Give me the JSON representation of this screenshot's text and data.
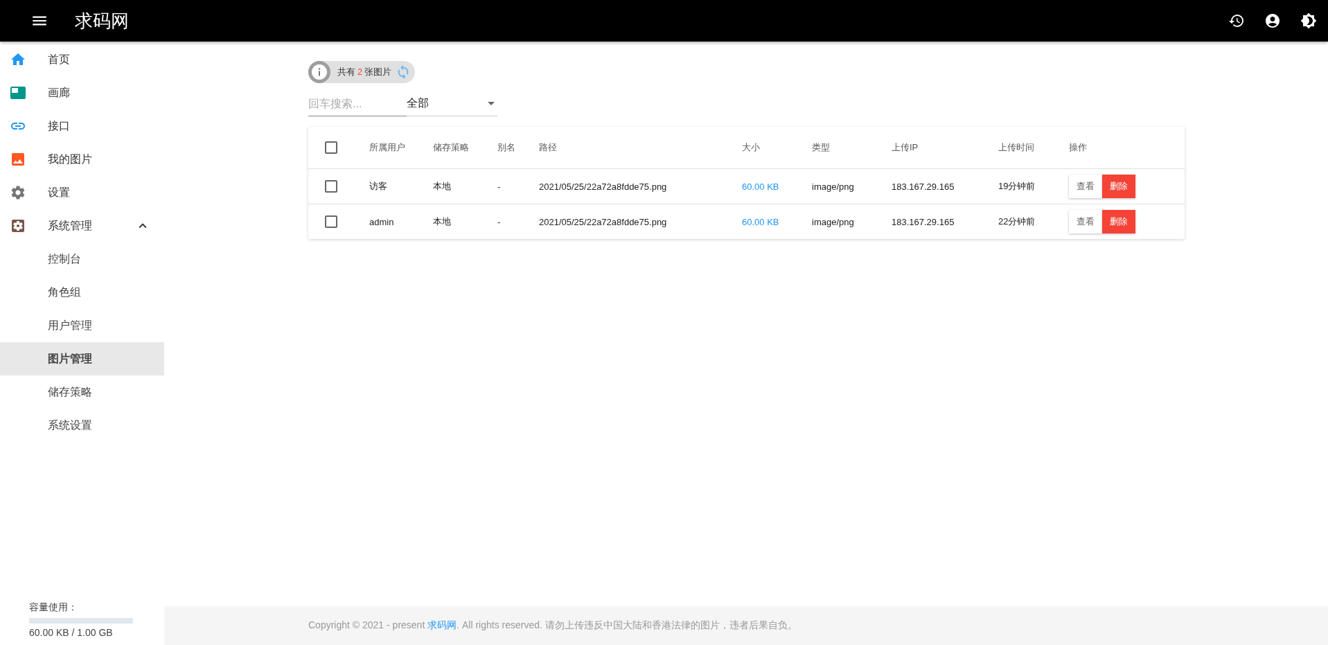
{
  "app_bar": {
    "title": "求码网"
  },
  "sidebar": {
    "items": [
      {
        "label": "首页",
        "selected": false
      },
      {
        "label": "画廊",
        "selected": false
      },
      {
        "label": "接口",
        "selected": false
      },
      {
        "label": "我的图片",
        "selected": false
      },
      {
        "label": "设置",
        "selected": false
      },
      {
        "label": "系统管理",
        "selected": false,
        "expanded": true,
        "children": [
          {
            "label": "控制台",
            "selected": false
          },
          {
            "label": "角色组",
            "selected": false
          },
          {
            "label": "用户管理",
            "selected": false
          },
          {
            "label": "图片管理",
            "selected": true
          },
          {
            "label": "储存策略",
            "selected": false
          },
          {
            "label": "系统设置",
            "selected": false
          }
        ]
      }
    ],
    "storage": {
      "label": "容量使用：",
      "level": 0,
      "reading": "60.00 KB / 1.00 GB"
    }
  },
  "count_chip": {
    "prefix": "共有",
    "count": "2",
    "suffix": "张图片"
  },
  "filters": {
    "search": {
      "placeholder": "回车搜索..."
    },
    "select": {
      "value": "全部"
    }
  },
  "table": {
    "columns": [
      {
        "label": "所属用户",
        "kind": "text"
      },
      {
        "label": "储存策略",
        "kind": "text"
      },
      {
        "label": "别名",
        "kind": "text"
      },
      {
        "label": "路径",
        "kind": "text"
      },
      {
        "label": "大小",
        "kind": "size"
      },
      {
        "label": "类型",
        "kind": "text"
      },
      {
        "label": "上传IP",
        "kind": "text"
      },
      {
        "label": "上传时间",
        "kind": "text"
      },
      {
        "label": "操作",
        "kind": "actions"
      }
    ],
    "header_checked": false,
    "rows": [
      {
        "checked": false,
        "cells": [
          "访客",
          "本地",
          "-",
          "2021/05/25/22a72a8fdde75.png",
          "60.00 KB",
          "image/png",
          "183.167.29.165",
          "19分钟前"
        ],
        "actions": [
          "查看",
          "删除"
        ]
      },
      {
        "checked": false,
        "cells": [
          "admin",
          "本地",
          "-",
          "2021/05/25/22a72a8fdde75.png",
          "60.00 KB",
          "image/png",
          "183.167.29.165",
          "22分钟前"
        ],
        "actions": [
          "查看",
          "删除"
        ]
      }
    ]
  },
  "footer": {
    "prefix": "Copyright © 2021 - present ",
    "link": "求码网",
    "suffix": ". All rights reserved. 请勿上传违反中国大陆和香港法律的图片，违者后果自负。"
  }
}
